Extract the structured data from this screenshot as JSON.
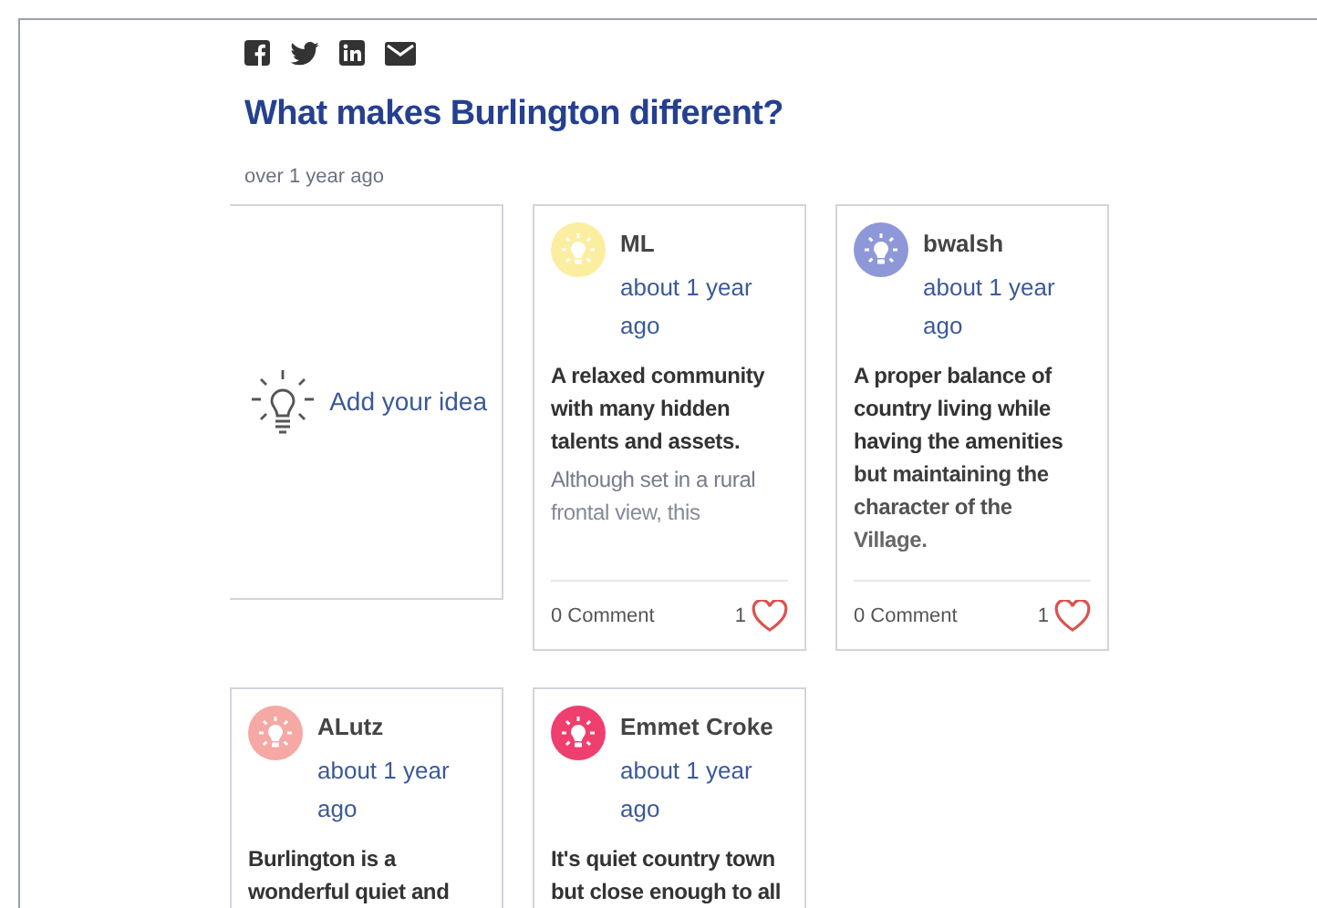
{
  "share_icons": [
    {
      "kind": "facebook"
    },
    {
      "kind": "twitter"
    },
    {
      "kind": "linkedin"
    },
    {
      "kind": "email"
    }
  ],
  "title": "What makes Burlington different?",
  "posted": "over 1 year ago",
  "add_idea": {
    "label": "Add your idea"
  },
  "ideas": [
    {
      "author": "ML",
      "color": "#fbeea0",
      "time": "about 1 year ago",
      "title": "A relaxed community with many hidden talents and assets.",
      "excerpt": "Although set in a rural frontal view, this",
      "comments": "0 Comment",
      "likes": "1"
    },
    {
      "author": "bwalsh",
      "color": "#8e98d8",
      "time": "about 1 year ago",
      "title": "A proper balance of country living while having the amenities but maintaining the character of the Village.",
      "comments": "0 Comment",
      "likes": "1"
    },
    {
      "author": "ALutz",
      "color": "#f6a8a4",
      "time": "about 1 year ago",
      "title": "Burlington is a wonderful quiet and"
    },
    {
      "author": "Emmet Croke",
      "color": "#ee3f6f",
      "time": "about 1 year ago",
      "title": "It's quiet country town but close enough to all"
    }
  ]
}
